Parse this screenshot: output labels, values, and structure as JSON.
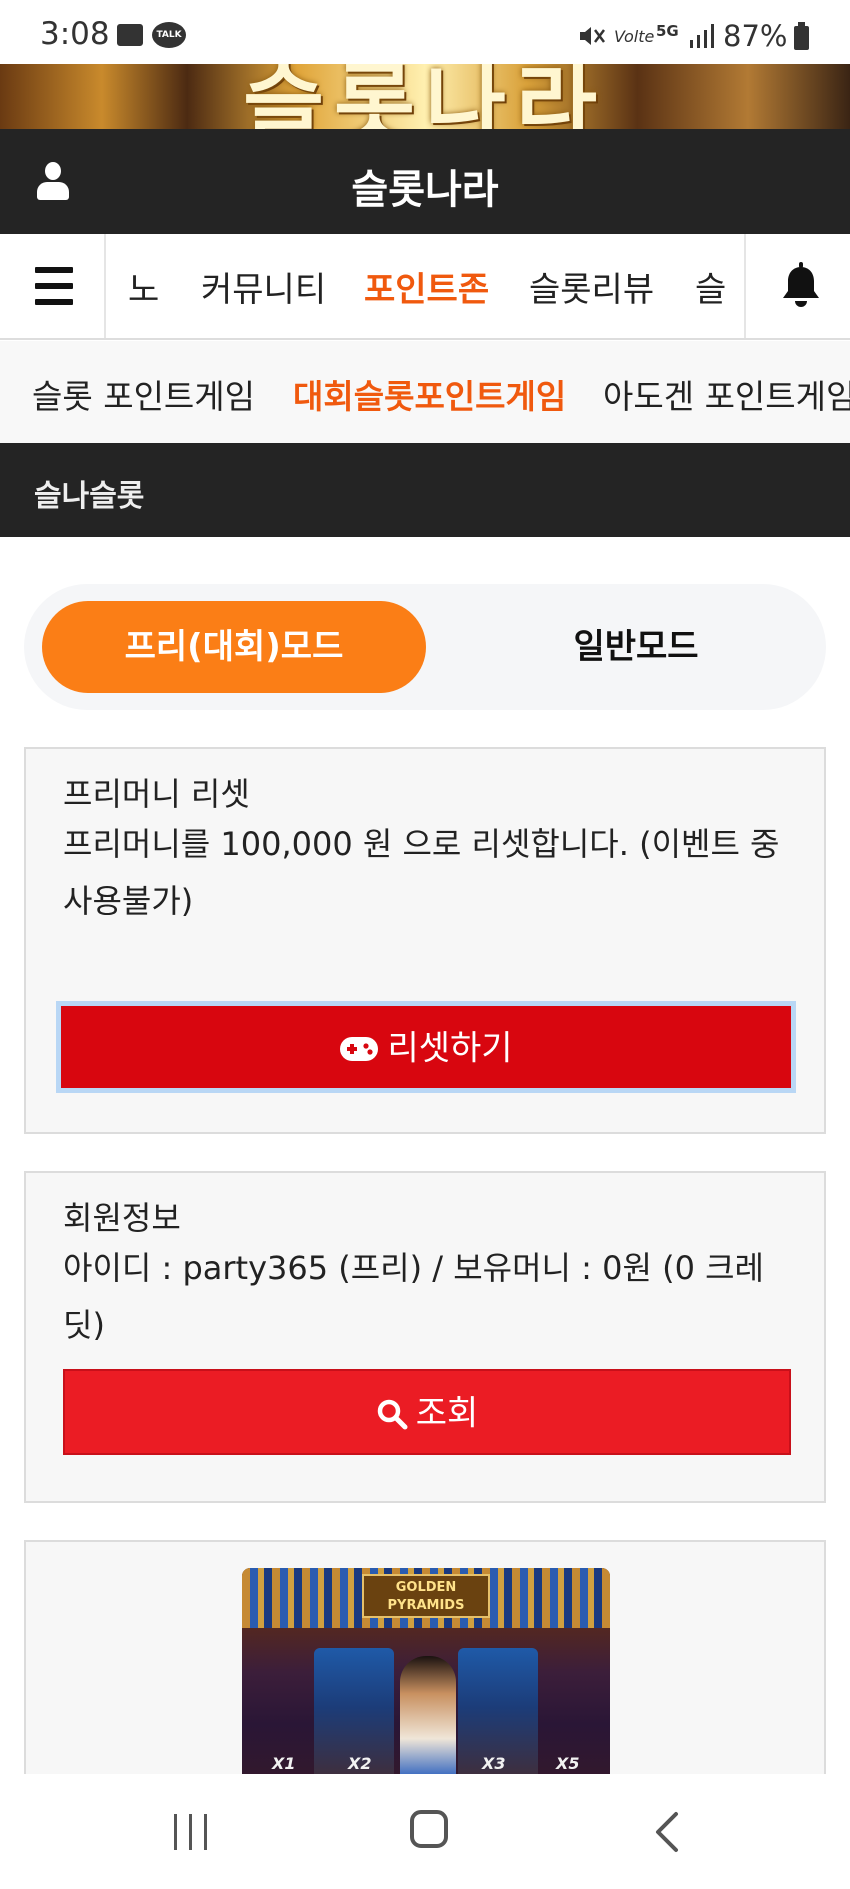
{
  "status_bar": {
    "time": "3:08",
    "talk_badge": "TALK",
    "volte": "Volte",
    "network": "5G",
    "battery": "87%"
  },
  "banner": {
    "text": "슬롯나라"
  },
  "header": {
    "title": "슬롯나라"
  },
  "nav": {
    "items": [
      {
        "label": "노"
      },
      {
        "label": "커뮤니티"
      },
      {
        "label": "포인트존",
        "active": true
      },
      {
        "label": "슬롯리뷰"
      },
      {
        "label": "슬"
      }
    ]
  },
  "subnav": {
    "items": [
      {
        "label": "슬롯 포인트게임"
      },
      {
        "label": "대회슬롯포인트게임",
        "active": true
      },
      {
        "label": "아도겐 포인트게임"
      }
    ]
  },
  "section": {
    "title": "슬나슬롯"
  },
  "mode_toggle": {
    "free_label": "프리(대회)모드",
    "normal_label": "일반모드",
    "selected": "free"
  },
  "reset_card": {
    "title": "프리머니 리셋",
    "text": "프리머니를 100,000 원 으로 리셋합니다. (이벤트 중 사용불가)",
    "button_label": "리셋하기"
  },
  "member_card": {
    "title": "회원정보",
    "text": "아이디 : party365 (프리) / 보유머니 : 0원 (0 크레딧)",
    "button_label": "조회"
  },
  "game_card": {
    "logo_text": "GOLDEN PYRAMIDS",
    "multipliers": [
      "X1",
      "X2",
      "X3",
      "X5"
    ]
  },
  "icons": {
    "user": "user-icon",
    "menu": "hamburger-icon",
    "bell": "bell-icon",
    "reset": "gamepad-icon",
    "search": "search-icon"
  },
  "colors": {
    "header_bg": "#242424",
    "accent_orange": "#f0590e",
    "toggle_active": "#fb7e16",
    "reset_button": "#d8060f",
    "search_button": "#eb1c24"
  }
}
